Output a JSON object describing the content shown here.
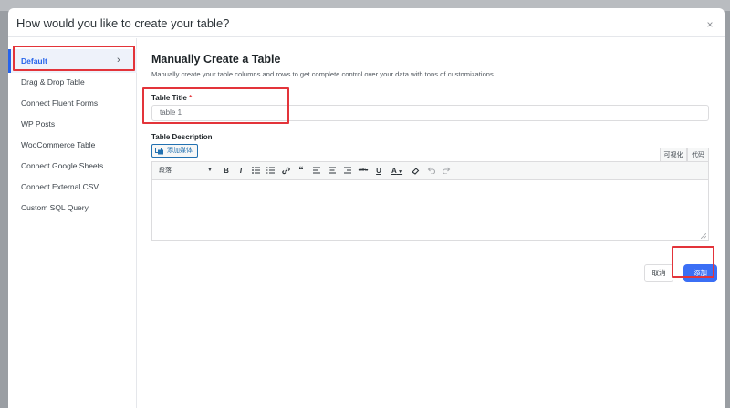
{
  "modal": {
    "title": "How would you like to create your table?",
    "close_label": "×"
  },
  "sidebar": {
    "items": [
      {
        "label": "Default",
        "active": true
      },
      {
        "label": "Drag & Drop Table"
      },
      {
        "label": "Connect Fluent Forms"
      },
      {
        "label": "WP Posts"
      },
      {
        "label": "WooCommerce Table"
      },
      {
        "label": "Connect Google Sheets"
      },
      {
        "label": "Connect External CSV"
      },
      {
        "label": "Custom SQL Query"
      }
    ],
    "chevron": "›"
  },
  "main": {
    "heading": "Manually Create a Table",
    "subtext": "Manually create your table columns and rows to get complete control over your data with tons of customizations.",
    "title_label": "Table Title",
    "required_mark": "*",
    "title_value": "table 1",
    "description_label": "Table Description",
    "add_media_label": "添加媒体",
    "tabs": {
      "visual": "可视化",
      "code": "代码"
    },
    "format_select": "段落",
    "toolbar": {
      "bold": "B",
      "italic": "I",
      "quote": "❝",
      "strikethrough": "ABC",
      "underline": "U",
      "text_color": "A"
    }
  },
  "footer": {
    "cancel_label": "取消",
    "add_label": "添加"
  },
  "colors": {
    "accent": "#3b6ff5",
    "highlight": "#e3343a",
    "active_text": "#2563eb"
  }
}
